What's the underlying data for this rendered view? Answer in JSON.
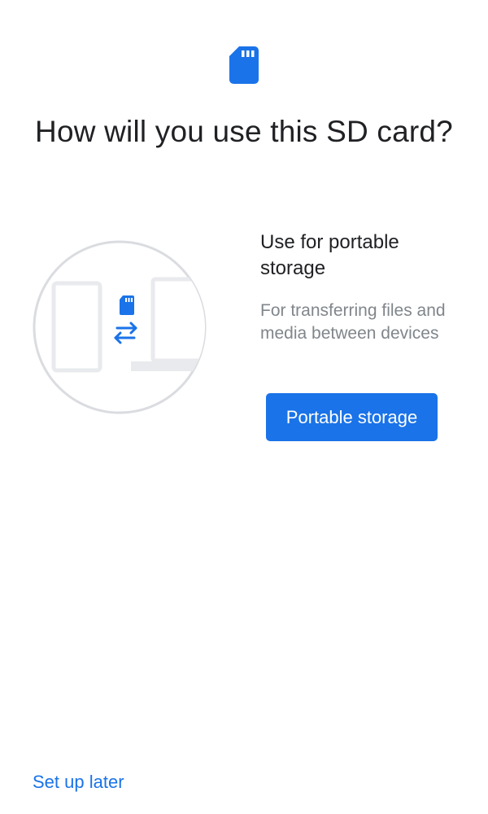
{
  "header": {
    "icon": "sd-card-icon",
    "title": "How will you use this SD card?"
  },
  "option": {
    "illustration": "phone-sd-card-transfer-to-computer-illustration",
    "title": "Use for portable storage",
    "description": "For transferring files and media between devices",
    "button_label": "Portable storage"
  },
  "footer": {
    "later_label": "Set up later"
  },
  "colors": {
    "accent": "#1a73e8",
    "text_primary": "#202124",
    "text_secondary": "#80868b",
    "illustration_line": "#dadce0"
  }
}
